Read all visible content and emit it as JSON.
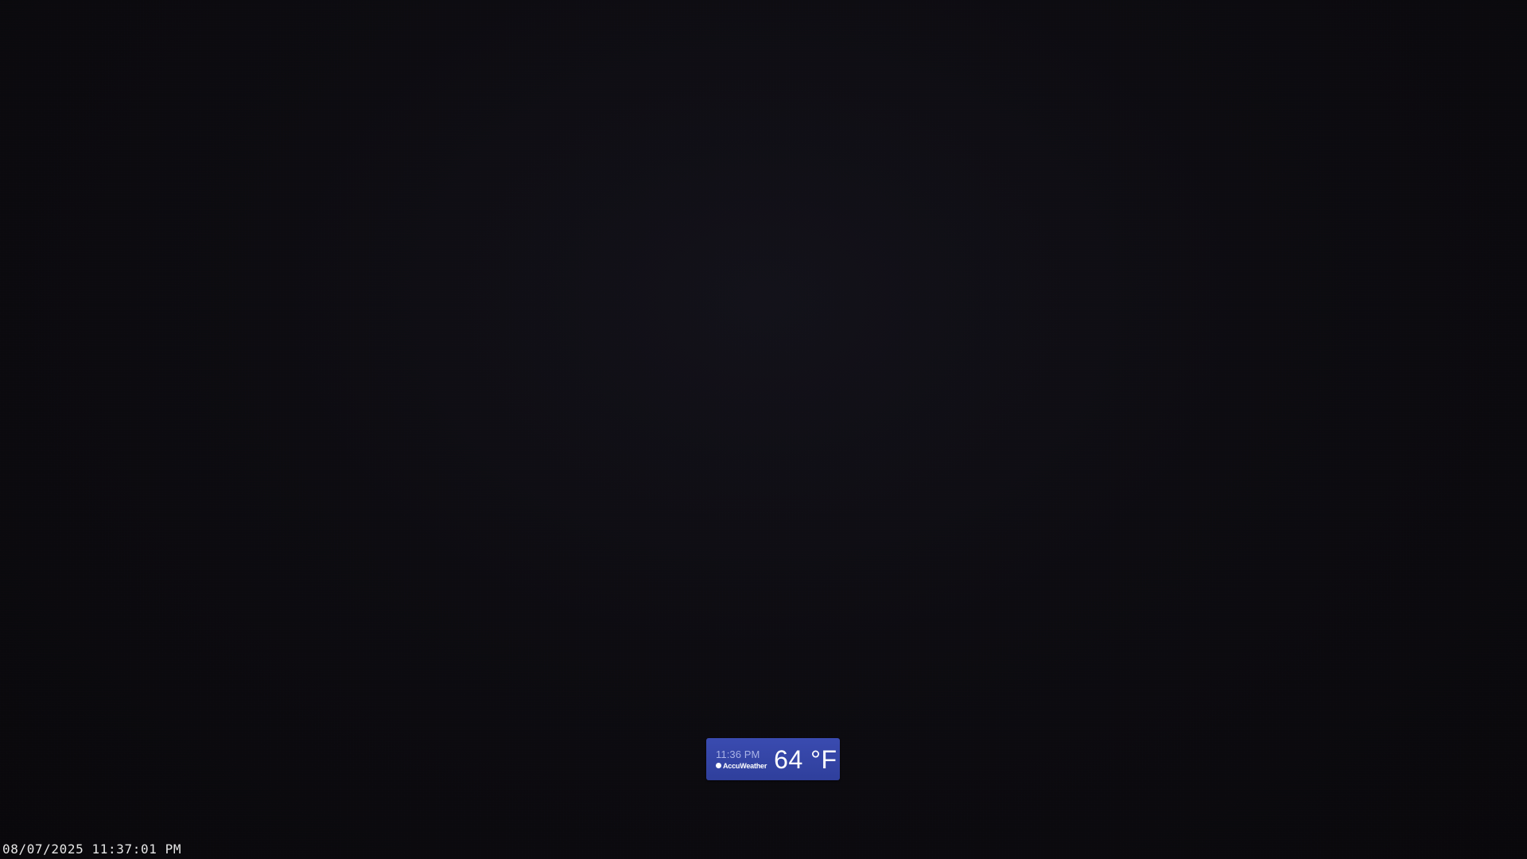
{
  "weather_badge": {
    "time": "11:36 PM",
    "brand": "AccuWeather",
    "temperature": "64 °F",
    "background_color": "#3a4bb0",
    "logo_icon": "accuweather-sun-icon"
  },
  "camera_overlay": {
    "timestamp": "08/07/2025 11:37:01 PM"
  },
  "colors": {
    "scene_background": "#0b0a0e",
    "overlay_text": "#e6e6e6"
  }
}
